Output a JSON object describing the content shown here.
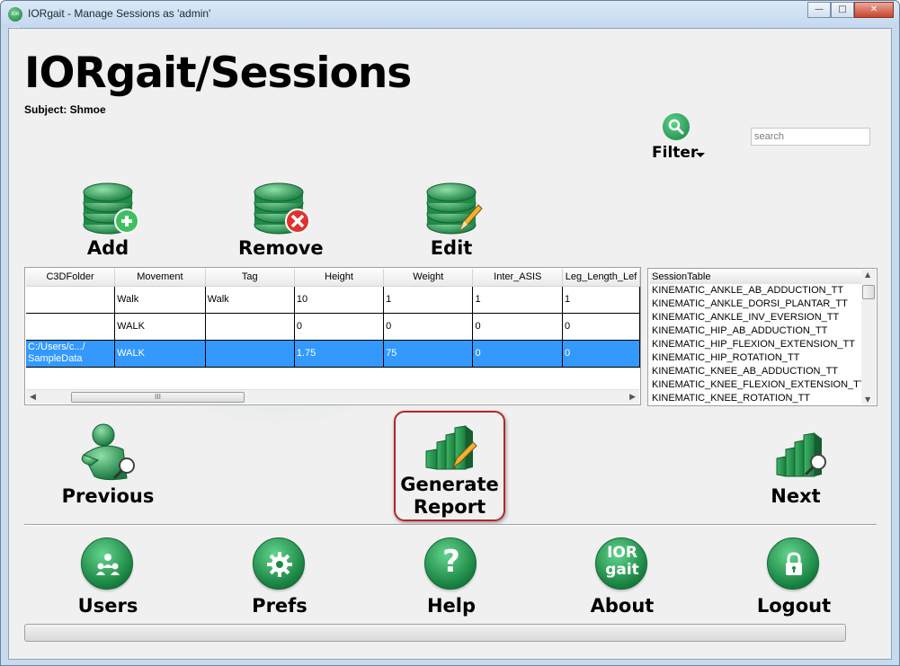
{
  "window": {
    "title": "IORgait - Manage Sessions as 'admin'",
    "app_icon": "IOR gait",
    "controls": [
      "minimize",
      "maximize",
      "close"
    ]
  },
  "header": {
    "title": "IORgait/Sessions",
    "subject": "Subject: Shmoe"
  },
  "filter": {
    "label": "Filter",
    "icon": "magnifier-icon"
  },
  "search": {
    "placeholder": "search",
    "value": ""
  },
  "actions": {
    "add": "Add",
    "remove": "Remove",
    "edit": "Edit"
  },
  "table": {
    "columns": [
      "C3DFolder",
      "Movement",
      "Tag",
      "Height",
      "Weight",
      "Inter_ASIS",
      "Leg_Length_Lef"
    ],
    "rows": [
      [
        "",
        "Walk",
        "Walk",
        "10",
        "1",
        "1",
        "1"
      ],
      [
        "",
        "WALK",
        "",
        "0",
        "0",
        "0",
        "0"
      ],
      [
        "C:/Users/c.../\nSampleData",
        "WALK",
        "",
        "1.75",
        "75",
        "0",
        "0"
      ]
    ],
    "selected_row": 2,
    "scroll_thumb": "III"
  },
  "session_list": {
    "header": "SessionTable",
    "items": [
      "KINEMATIC_ANKLE_AB_ADDUCTION_TT",
      "KINEMATIC_ANKLE_DORSI_PLANTAR_TT",
      "KINEMATIC_ANKLE_INV_EVERSION_TT",
      "KINEMATIC_HIP_AB_ADDUCTION_TT",
      "KINEMATIC_HIP_FLEXION_EXTENSION_TT",
      "KINEMATIC_HIP_ROTATION_TT",
      "KINEMATIC_KNEE_AB_ADDUCTION_TT",
      "KINEMATIC_KNEE_FLEXION_EXTENSION_TT",
      "KINEMATIC_KNEE_ROTATION_TT"
    ]
  },
  "nav": {
    "previous": "Previous",
    "generate_line1": "Generate",
    "generate_line2": "Report",
    "next": "Next"
  },
  "bottom": {
    "users": "Users",
    "prefs": "Prefs",
    "help": "Help",
    "about": "About",
    "about_icon_line1": "IOR",
    "about_icon_line2": "gait",
    "logout": "Logout"
  },
  "colors": {
    "accent_green": "#17803f",
    "selection_blue": "#3399ff",
    "highlight_border": "#b5242c"
  }
}
